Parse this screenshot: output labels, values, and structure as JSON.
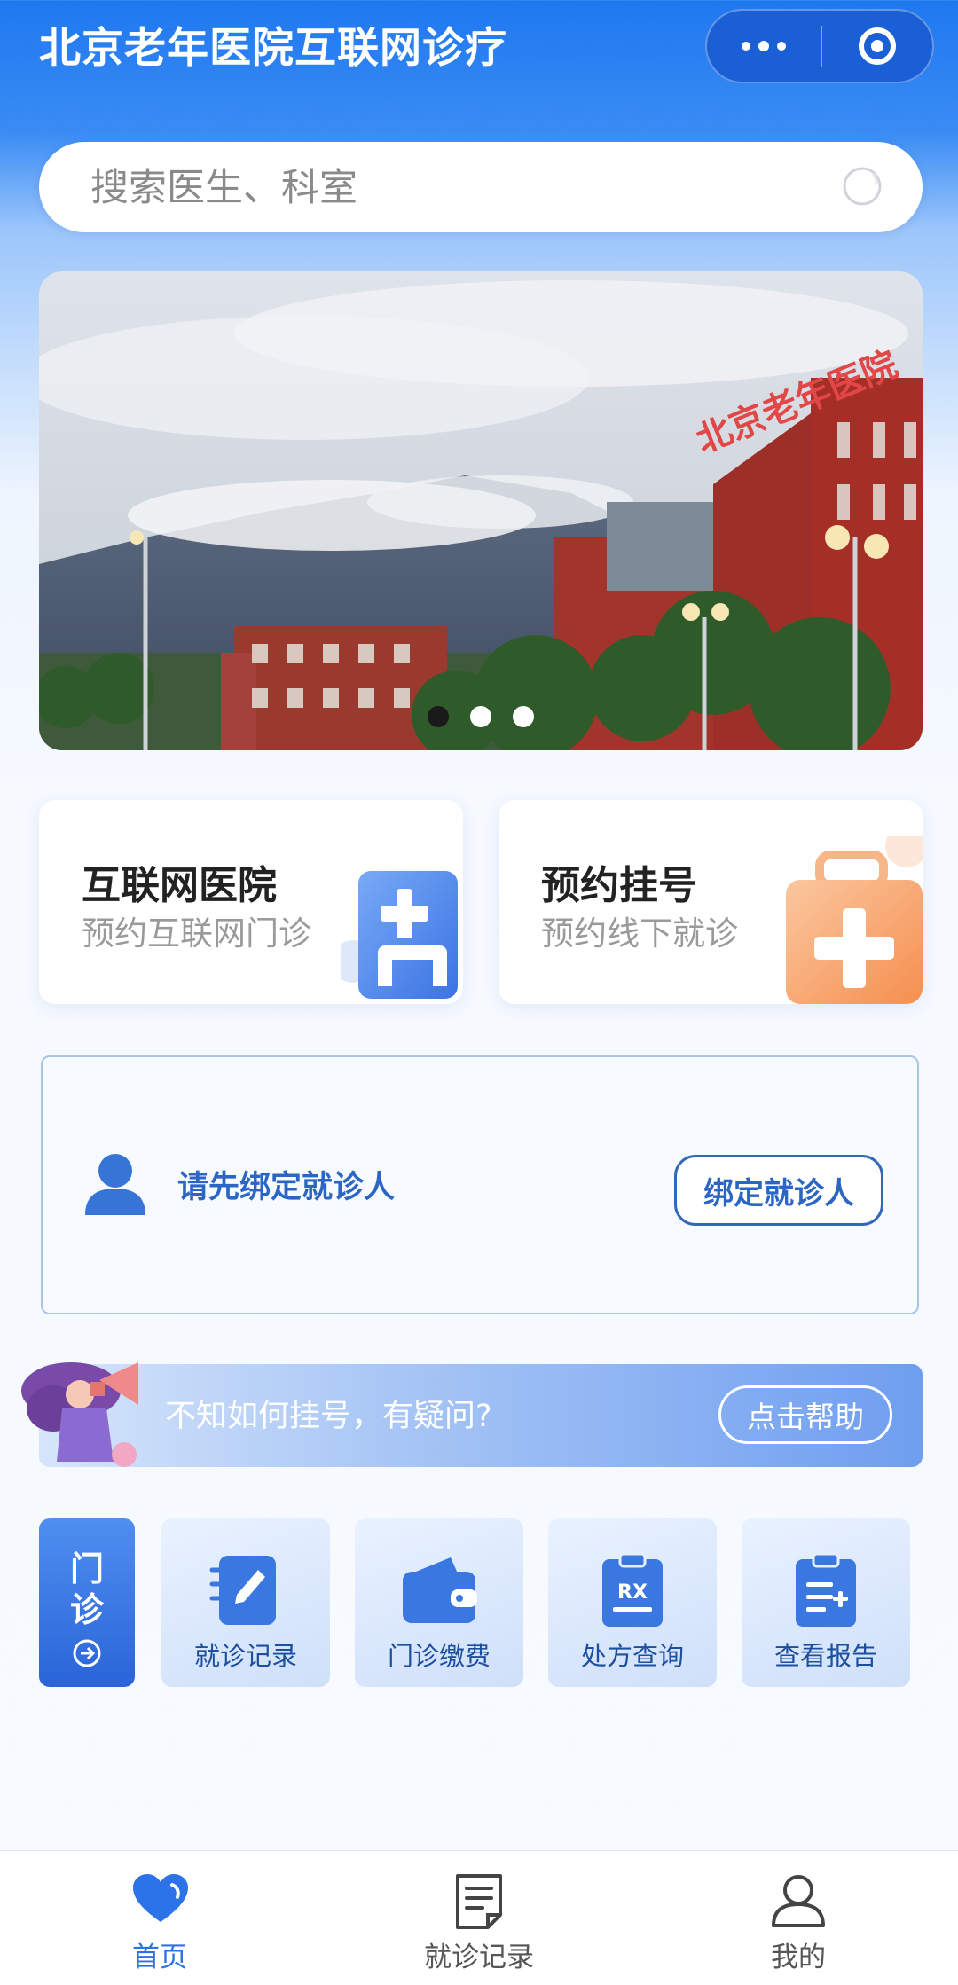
{
  "header": {
    "title": "北京老年医院互联网诊疗",
    "capsule": {
      "more_icon": "more-dots-icon",
      "close_icon": "target-icon"
    }
  },
  "search": {
    "placeholder": "搜索医生、科室",
    "icon": "search-icon"
  },
  "banner": {
    "sign_text": "北京老年医院",
    "carousel": {
      "count": 3,
      "active_index": 0
    }
  },
  "services": [
    {
      "title": "互联网医院",
      "subtitle": "预约互联网门诊",
      "icon": "internet-hospital-icon"
    },
    {
      "title": "预约挂号",
      "subtitle": "预约线下就诊",
      "icon": "medical-kit-icon"
    }
  ],
  "bind_patient": {
    "prompt": "请先绑定就诊人",
    "button": "绑定就诊人",
    "icon": "person-icon"
  },
  "help": {
    "text": "不知如何挂号，有疑问?",
    "button": "点击帮助",
    "icon": "megaphone-girl-illustration"
  },
  "quick_actions": {
    "outpatient": {
      "chars": [
        "门",
        "诊"
      ],
      "icon": "arrow-right-circle-icon"
    },
    "items": [
      {
        "label": "就诊记录",
        "icon": "notebook-pen-icon"
      },
      {
        "label": "门诊缴费",
        "icon": "wallet-icon"
      },
      {
        "label": "处方查询",
        "icon": "rx-clipboard-icon"
      },
      {
        "label": "查看报告",
        "icon": "report-clipboard-icon"
      }
    ]
  },
  "bottom_nav": {
    "items": [
      {
        "label": "首页",
        "icon": "heart-home-icon",
        "active": true
      },
      {
        "label": "就诊记录",
        "icon": "document-icon",
        "active": false
      },
      {
        "label": "我的",
        "icon": "user-icon",
        "active": false
      }
    ]
  },
  "colors": {
    "primary": "#1f78f0",
    "accent_text": "#2c66c4",
    "nav_active": "#2c72e8",
    "nav_inactive": "#555555",
    "orange": "#f5a36c"
  }
}
